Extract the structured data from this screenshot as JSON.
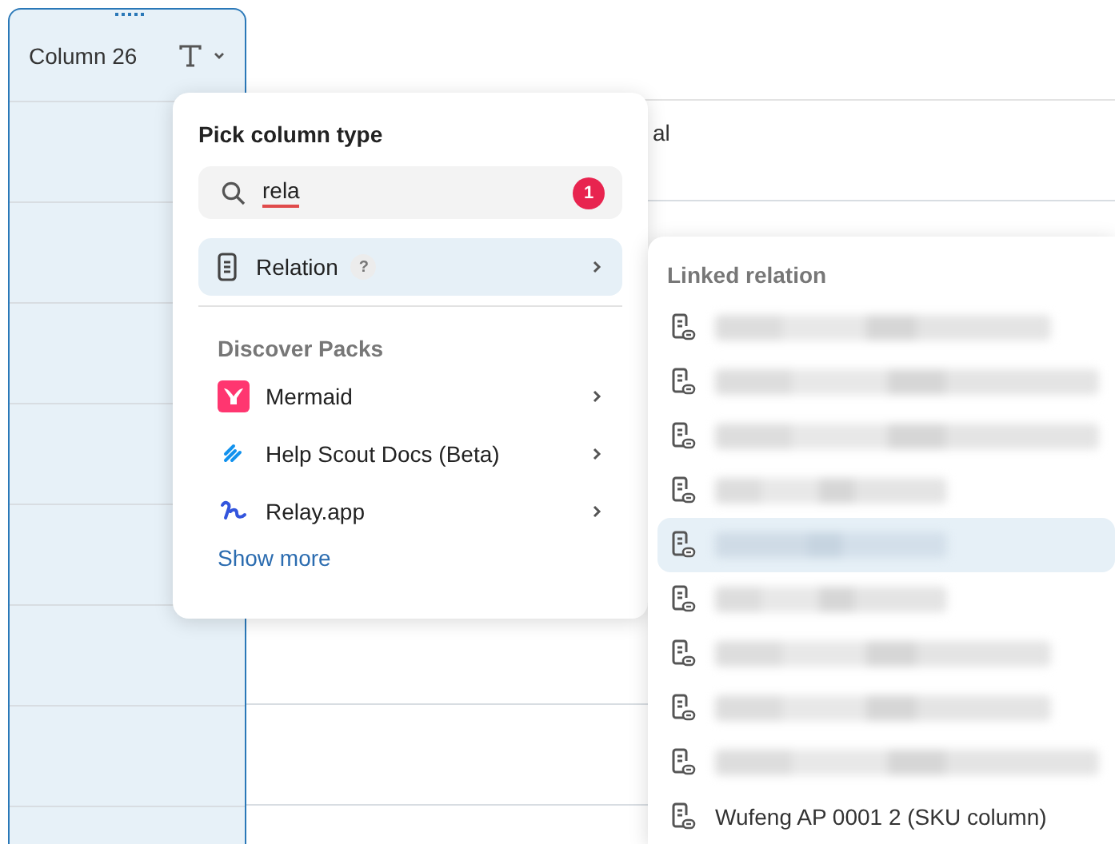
{
  "table": {
    "column": {
      "title": "Column 26",
      "selected": true
    },
    "cell_fragment": "al"
  },
  "column_type_menu": {
    "title": "Pick column type",
    "search": {
      "value": "rela",
      "misspelled": true,
      "badge": "1"
    },
    "results": [
      {
        "label": "Relation",
        "help": "?",
        "selected": true
      }
    ],
    "section": "Discover Packs",
    "packs": [
      {
        "label": "Mermaid",
        "kind": "mermaid"
      },
      {
        "label": "Help Scout Docs (Beta)",
        "kind": "helpscout"
      },
      {
        "label": "Relay.app",
        "kind": "relay"
      }
    ],
    "show_more": "Show more"
  },
  "submenu": {
    "title": "Linked relation",
    "items": [
      {
        "kind": "redacted",
        "selected": false
      },
      {
        "kind": "redacted",
        "selected": false
      },
      {
        "kind": "redacted",
        "selected": false
      },
      {
        "kind": "redacted",
        "selected": false
      },
      {
        "kind": "redacted",
        "selected": true
      },
      {
        "kind": "redacted",
        "selected": false
      },
      {
        "kind": "redacted",
        "selected": false
      },
      {
        "kind": "redacted",
        "selected": false
      },
      {
        "kind": "redacted",
        "selected": false
      },
      {
        "kind": "text",
        "label": "Wufeng AP 0001 2 (SKU column)",
        "selected": false
      }
    ]
  }
}
